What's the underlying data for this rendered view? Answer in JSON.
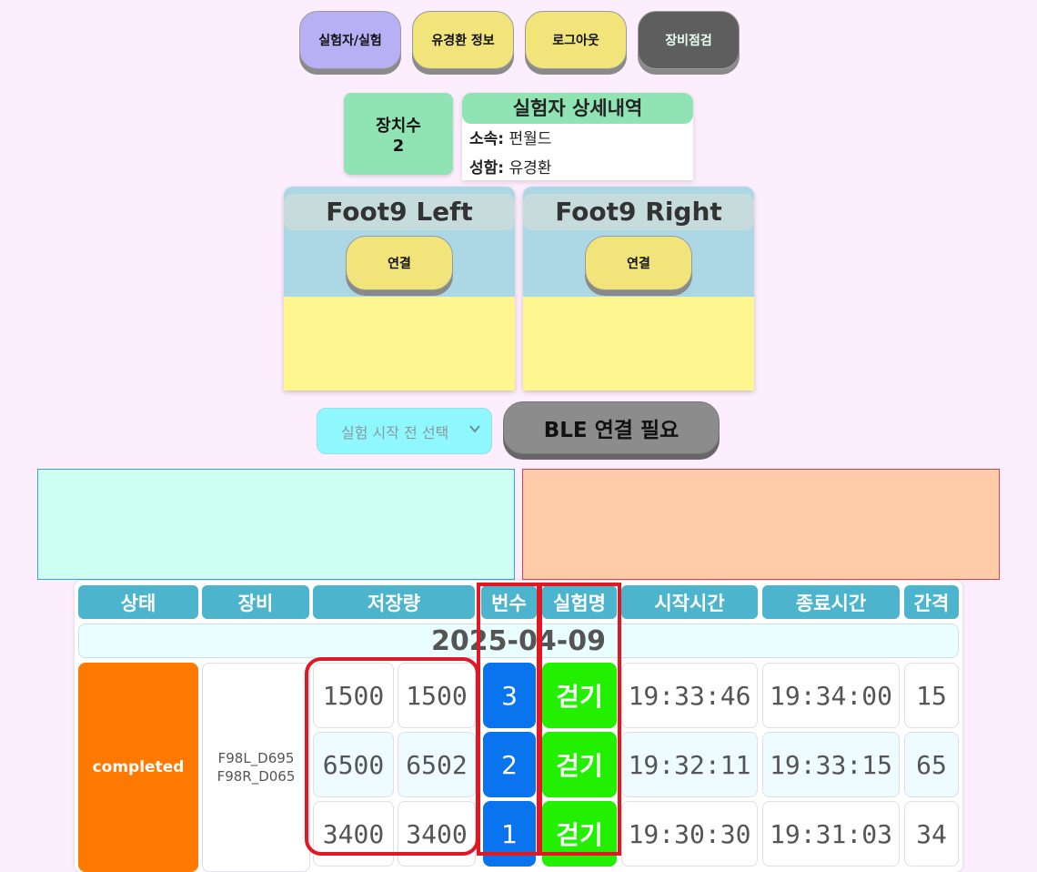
{
  "nav": {
    "experiment": "실험자/실험",
    "user_info": "유경환 정보",
    "logout": "로그아웃",
    "equipment_check": "장비점검"
  },
  "device_count": {
    "label": "장치수",
    "value": "2"
  },
  "detail": {
    "title": "실험자 상세내역",
    "affiliation_label": "소속:",
    "affiliation": "펀월드",
    "name_label": "성함:",
    "name": "유경환"
  },
  "feet": [
    {
      "title": "Foot9 Left",
      "connect": "연결"
    },
    {
      "title": "Foot9 Right",
      "connect": "연결"
    }
  ],
  "select": {
    "placeholder": "실험 시작 전 선택"
  },
  "ble_button": "BLE 연결 필요",
  "table": {
    "headers": [
      "상태",
      "장비",
      "저장량",
      "번수",
      "실험명",
      "시작시간",
      "종료시간",
      "간격"
    ],
    "date": "2025-04-09",
    "status": "completed",
    "devices": [
      "F98L_D695",
      "F98R_D065"
    ],
    "rows": [
      {
        "left": "1500",
        "right": "1500",
        "num": "3",
        "name": "걷기",
        "start": "19:33:46",
        "end": "19:34:00",
        "interval": "15"
      },
      {
        "left": "6500",
        "right": "6502",
        "num": "2",
        "name": "걷기",
        "start": "19:32:11",
        "end": "19:33:15",
        "interval": "65"
      },
      {
        "left": "3400",
        "right": "3400",
        "num": "1",
        "name": "걷기",
        "start": "19:30:30",
        "end": "19:31:03",
        "interval": "34"
      }
    ]
  }
}
